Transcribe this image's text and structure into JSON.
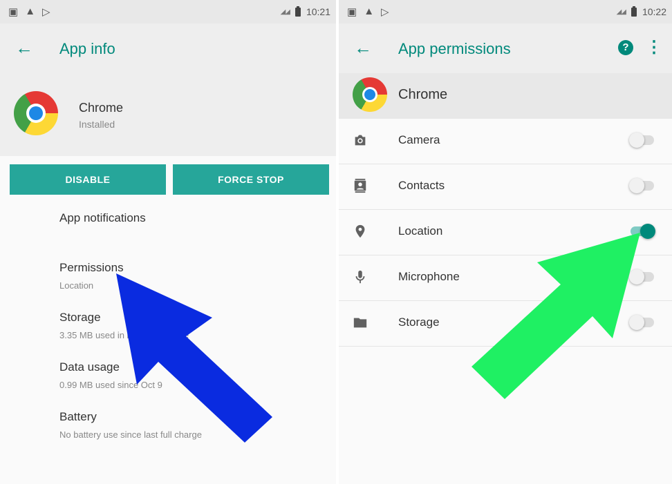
{
  "left": {
    "status": {
      "time": "10:21"
    },
    "appbar": {
      "title": "App info"
    },
    "app": {
      "name": "Chrome",
      "status": "Installed"
    },
    "buttons": {
      "disable": "DISABLE",
      "force_stop": "FORCE STOP"
    },
    "settings": [
      {
        "title": "App notifications",
        "subtitle": ""
      },
      {
        "title": "Permissions",
        "subtitle": "Location"
      },
      {
        "title": "Storage",
        "subtitle": "3.35 MB used in internal storage"
      },
      {
        "title": "Data usage",
        "subtitle": "0.99 MB used since Oct 9"
      },
      {
        "title": "Battery",
        "subtitle": "No battery use since last full charge"
      }
    ]
  },
  "right": {
    "status": {
      "time": "10:22"
    },
    "appbar": {
      "title": "App permissions",
      "help": "?",
      "more": "⋮"
    },
    "app": {
      "name": "Chrome"
    },
    "permissions": [
      {
        "label": "Camera",
        "icon": "camera-icon",
        "enabled": false
      },
      {
        "label": "Contacts",
        "icon": "contacts-icon",
        "enabled": false
      },
      {
        "label": "Location",
        "icon": "location-pin-icon",
        "enabled": true
      },
      {
        "label": "Microphone",
        "icon": "microphone-icon",
        "enabled": false
      },
      {
        "label": "Storage",
        "icon": "folder-icon",
        "enabled": false
      }
    ]
  },
  "colors": {
    "accent": "#00897b",
    "button": "#26a69a",
    "blue_arrow": "#0a2be0",
    "green_arrow": "#1ff063"
  }
}
